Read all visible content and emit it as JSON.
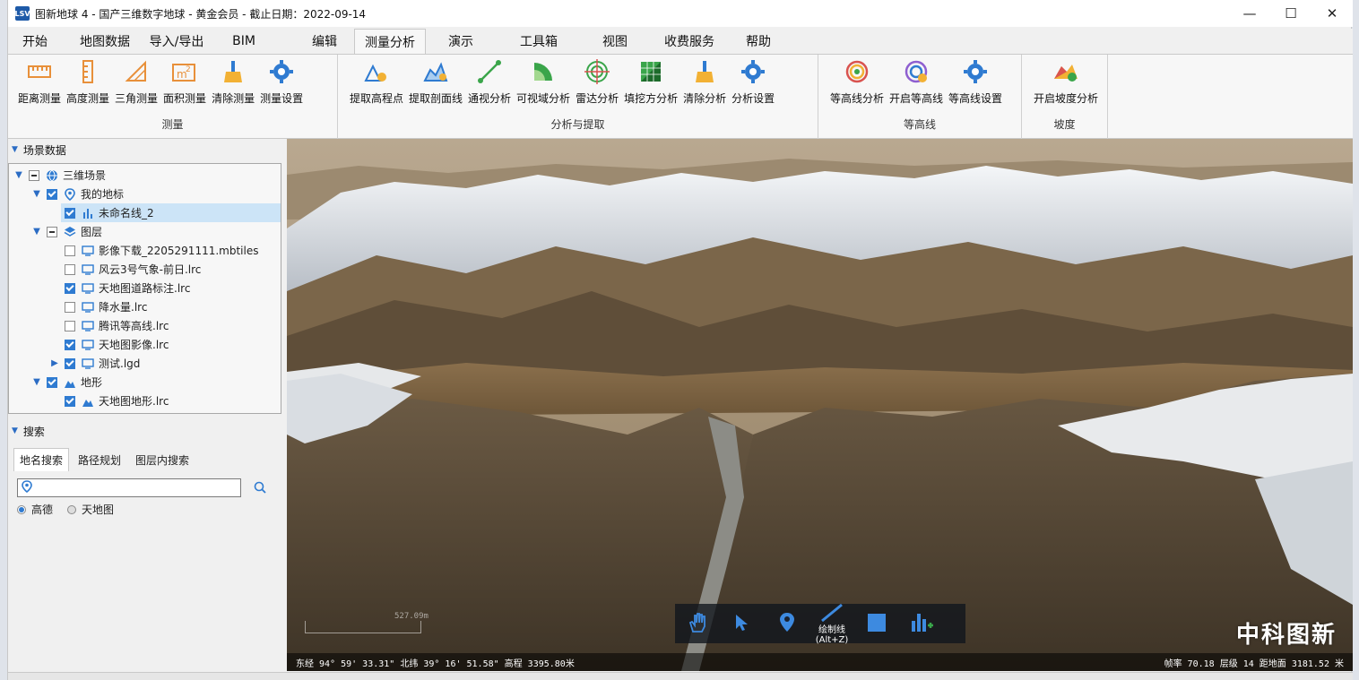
{
  "window": {
    "title": "图新地球 4 - 国产三维数字地球 - 黄金会员 - 截止日期：2022-09-14",
    "logo_text": "LSV",
    "minimize": "—",
    "maximize": "☐",
    "close": "✕"
  },
  "menu": [
    "开始",
    "地图数据",
    "导入/导出",
    "BIM",
    "编辑",
    "测量分析",
    "演示",
    "工具箱",
    "视图",
    "收费服务",
    "帮助"
  ],
  "ribbon": {
    "measure": {
      "name": "测量",
      "buttons": [
        "距离测量",
        "高度测量",
        "三角测量",
        "面积测量",
        "清除测量",
        "测量设置"
      ]
    },
    "analysis": {
      "name": "分析与提取",
      "buttons": [
        "提取高程点",
        "提取剖面线",
        "通视分析",
        "可视域分析",
        "雷达分析",
        "填挖方分析",
        "清除分析",
        "分析设置"
      ]
    },
    "contour": {
      "name": "等高线",
      "buttons": [
        "等高线分析",
        "开启等高线",
        "等高线设置"
      ]
    },
    "slope": {
      "name": "坡度",
      "buttons": [
        "开启坡度分析"
      ]
    }
  },
  "scene_panel": {
    "title": "场景数据",
    "items": [
      "三维场景",
      "我的地标",
      "未命名线_2",
      "图层",
      "影像下载_2205291111.mbtiles",
      "风云3号气象-前日.lrc",
      "天地图道路标注.lrc",
      "降水量.lrc",
      "腾讯等高线.lrc",
      "天地图影像.lrc",
      "测试.lgd",
      "地形",
      "天地图地形.lrc"
    ]
  },
  "search_panel": {
    "title": "搜索",
    "tabs": [
      "地名搜索",
      "路径规划",
      "图层内搜索"
    ],
    "input_value": "",
    "providers": [
      "高德",
      "天地图"
    ]
  },
  "viewport": {
    "tool_tip": "绘制线",
    "tool_shortcut": "(Alt+Z)",
    "watermark": "中科图新",
    "scale_label": "527.09m",
    "status_left": "东经 94° 59' 33.31\"  北纬 39° 16' 51.58\"  高程 3395.80米",
    "status_right": "帧率 70.18  层级 14  距地面 3181.52 米"
  },
  "colors": {
    "accent": "#2f7bd1",
    "selection": "#cce4f7"
  }
}
